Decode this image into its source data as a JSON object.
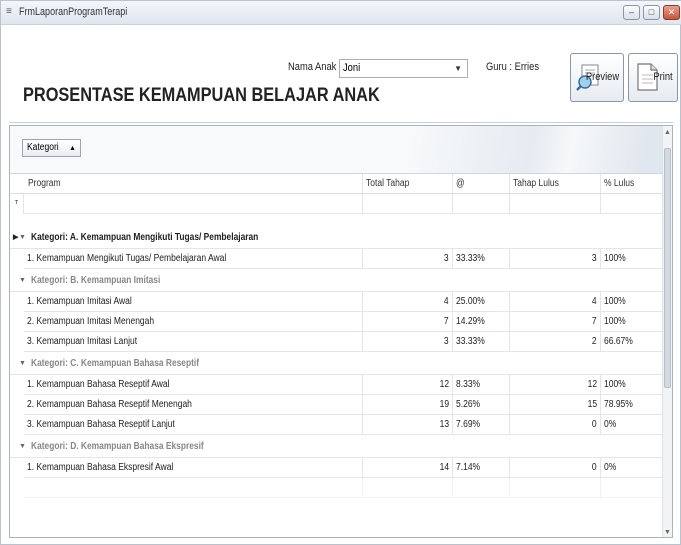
{
  "window": {
    "title": "FrmLaporanProgramTerapi"
  },
  "header": {
    "title": "PROSENTASE KEMAMPUAN BELAJAR ANAK",
    "nama_anak_label": "Nama Anak",
    "nama_anak_value": "Joni",
    "guru_text": "Guru : Erries",
    "preview_label": "Preview",
    "print_label": "Print"
  },
  "grid": {
    "group_panel_label": "Kategori",
    "columns": [
      "Program",
      "Total Tahap",
      "@",
      "Tahap Lulus",
      "% Lulus"
    ],
    "groups": [
      {
        "title": "Kategori: A. Kemampuan Mengikuti Tugas/ Pembelajaran",
        "rows": [
          {
            "program": "1. Kemampuan Mengikuti Tugas/ Pembelajaran Awal",
            "total": "3",
            "at": "33.33%",
            "lulus": "3",
            "pct": "100%"
          }
        ]
      },
      {
        "title": "Kategori: B. Kemampuan Imitasi",
        "rows": [
          {
            "program": "1. Kemampuan Imitasi Awal",
            "total": "4",
            "at": "25.00%",
            "lulus": "4",
            "pct": "100%"
          },
          {
            "program": "2. Kemampuan Imitasi Menengah",
            "total": "7",
            "at": "14.29%",
            "lulus": "7",
            "pct": "100%"
          },
          {
            "program": "3. Kemampuan Imitasi Lanjut",
            "total": "3",
            "at": "33.33%",
            "lulus": "2",
            "pct": "66.67%"
          }
        ]
      },
      {
        "title": "Kategori: C. Kemampuan Bahasa Reseptif",
        "rows": [
          {
            "program": "1. Kemampuan Bahasa Reseptif Awal",
            "total": "12",
            "at": "8.33%",
            "lulus": "12",
            "pct": "100%"
          },
          {
            "program": "2. Kemampuan Bahasa Reseptif Menengah",
            "total": "19",
            "at": "5.26%",
            "lulus": "15",
            "pct": "78.95%"
          },
          {
            "program": "3. Kemampuan Bahasa Reseptif Lanjut",
            "total": "13",
            "at": "7.69%",
            "lulus": "0",
            "pct": "0%"
          }
        ]
      },
      {
        "title": "Kategori: D. Kemampuan Bahasa Ekspresif",
        "rows": [
          {
            "program": "1. Kemampuan Bahasa Ekspresif Awal",
            "total": "14",
            "at": "7.14%",
            "lulus": "0",
            "pct": "0%"
          }
        ]
      }
    ]
  }
}
